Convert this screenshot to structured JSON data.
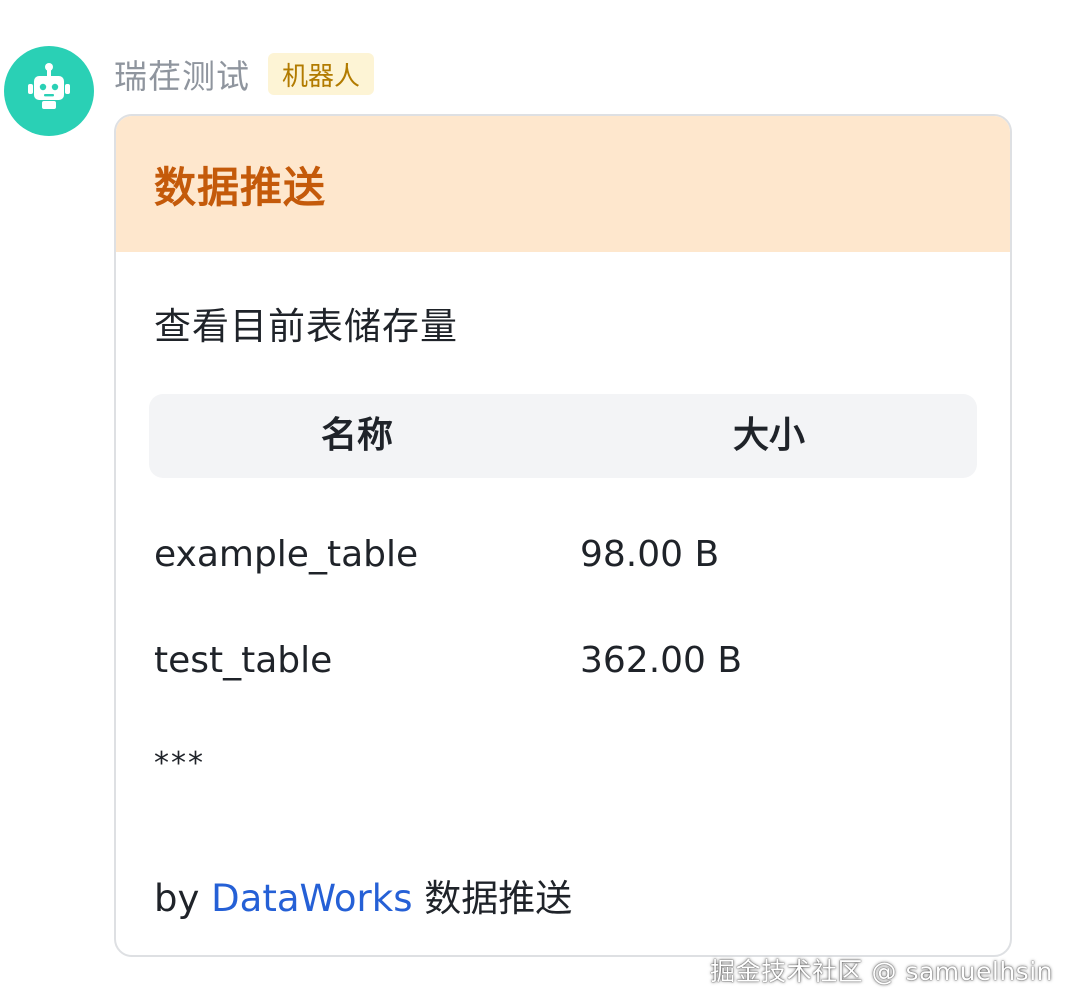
{
  "message": {
    "sender_name": "瑞荏测试",
    "sender_tag": "机器人",
    "avatar_icon": "robot-icon",
    "avatar_color": "#2ad0b5"
  },
  "card": {
    "header_color": "#fee7cd",
    "title_color": "#c45a0a",
    "title": "数据推送",
    "subtitle": "查看目前表储存量",
    "table": {
      "columns": [
        "名称",
        "大小"
      ],
      "rows": [
        [
          "example_table",
          "98.00 B"
        ],
        [
          "test_table",
          "362.00 B"
        ]
      ]
    },
    "separator": "***",
    "footer": {
      "prefix": "by",
      "link_text": "DataWorks",
      "suffix": "数据推送"
    }
  },
  "watermark": "掘金技术社区 @ samuelhsin"
}
